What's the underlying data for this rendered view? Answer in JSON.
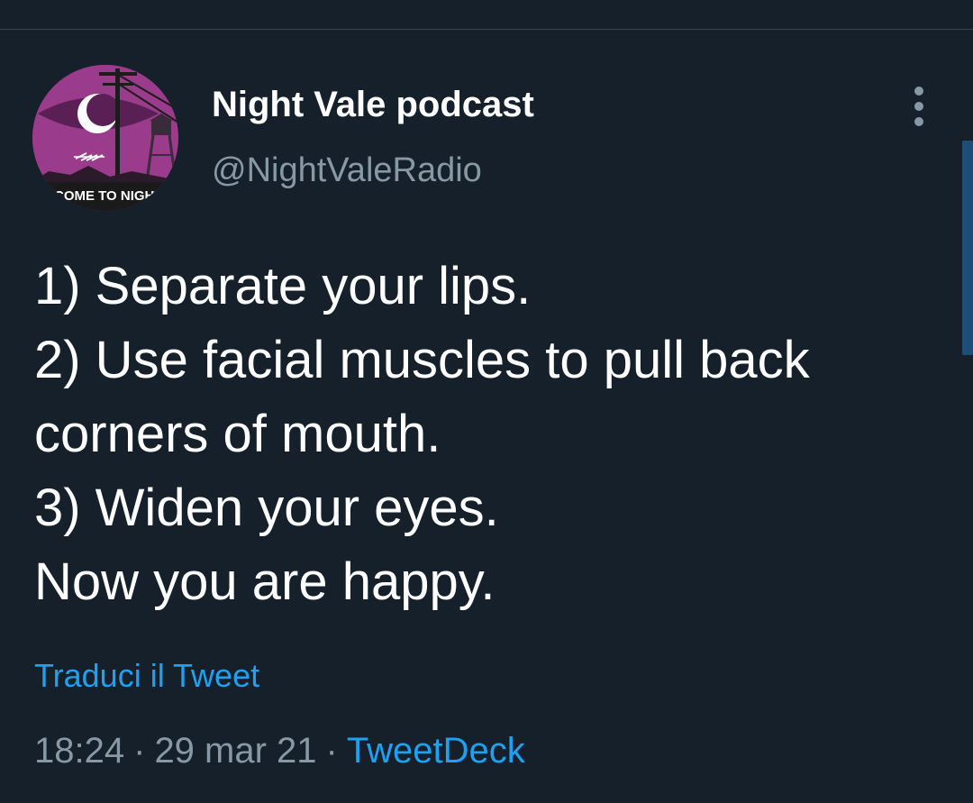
{
  "author": {
    "display_name": "Night Vale podcast",
    "handle": "@NightValeRadio",
    "avatar_text": "COME TO NIGHT V"
  },
  "tweet": {
    "lines": [
      "1) Separate your lips.",
      "2) Use facial muscles to pull back",
      "corners of mouth.",
      "3) Widen your eyes.",
      "Now you are happy."
    ],
    "translate_label": "Traduci il Tweet",
    "time": "18:24",
    "separator": "·",
    "date": "29 mar 21",
    "source": "TweetDeck"
  },
  "colors": {
    "background": "#15202b",
    "text_primary": "#ffffff",
    "text_secondary": "#8899a6",
    "link": "#1da1f2",
    "avatar_background": "#9b3b8b"
  },
  "icons": {
    "more": "more-vertical-icon"
  }
}
